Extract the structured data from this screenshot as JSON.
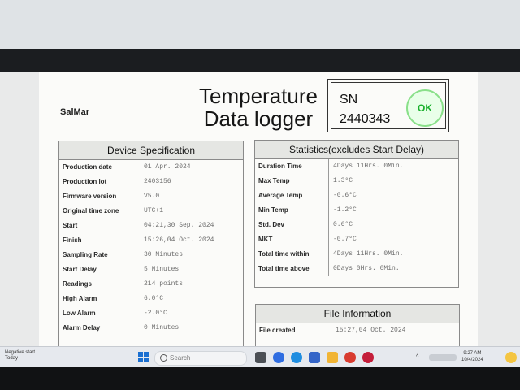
{
  "header": {
    "brand": "SalMar",
    "title_line1": "Temperature",
    "title_line2": "Data logger",
    "sn_label": "SN",
    "sn_value": "2440343",
    "status": "OK",
    "status_color": "#1bb12e"
  },
  "device_spec": {
    "title": "Device Specification",
    "rows": [
      {
        "k": "Production date",
        "v": "01 Apr. 2024"
      },
      {
        "k": "Production lot",
        "v": "2403156"
      },
      {
        "k": "Firmware version",
        "v": "V5.0"
      },
      {
        "k": "Original time zone",
        "v": "UTC+1"
      },
      {
        "k": "Start",
        "v": "04:21,30 Sep. 2024"
      },
      {
        "k": "Finish",
        "v": "15:26,04 Oct. 2024"
      },
      {
        "k": "Sampling Rate",
        "v": "30 Minutes"
      },
      {
        "k": "Start Delay",
        "v": "5 Minutes"
      },
      {
        "k": "Readings",
        "v": "214 points"
      },
      {
        "k": "High Alarm",
        "v": "6.0°C"
      },
      {
        "k": "Low Alarm",
        "v": "-2.0°C"
      },
      {
        "k": "Alarm Delay",
        "v": "0 Minutes"
      }
    ]
  },
  "statistics": {
    "title": "Statistics(excludes Start Delay)",
    "rows": [
      {
        "k": "Duration Time",
        "v": "4Days 11Hrs. 0Min."
      },
      {
        "k": "Max Temp",
        "v": "1.3°C"
      },
      {
        "k": "Average Temp",
        "v": "-0.6°C"
      },
      {
        "k": "Min Temp",
        "v": "-1.2°C"
      },
      {
        "k": "Std. Dev",
        "v": "0.6°C"
      },
      {
        "k": "MKT",
        "v": "-0.7°C"
      },
      {
        "k": "Total time within",
        "v": "4Days 11Hrs. 0Min."
      },
      {
        "k": "Total time above",
        "v": "0Days 0Hrs. 0Min."
      }
    ]
  },
  "file_info": {
    "title": "File Information",
    "rows": [
      {
        "k": "File created",
        "v": "15:27,04 Oct. 2024"
      }
    ]
  },
  "taskbar": {
    "notice_line1": "Negative start",
    "notice_line2": "Today",
    "search_placeholder": "Search",
    "time": "9:27 AM",
    "date": "10/4/2024",
    "tray_chevron": "^"
  }
}
